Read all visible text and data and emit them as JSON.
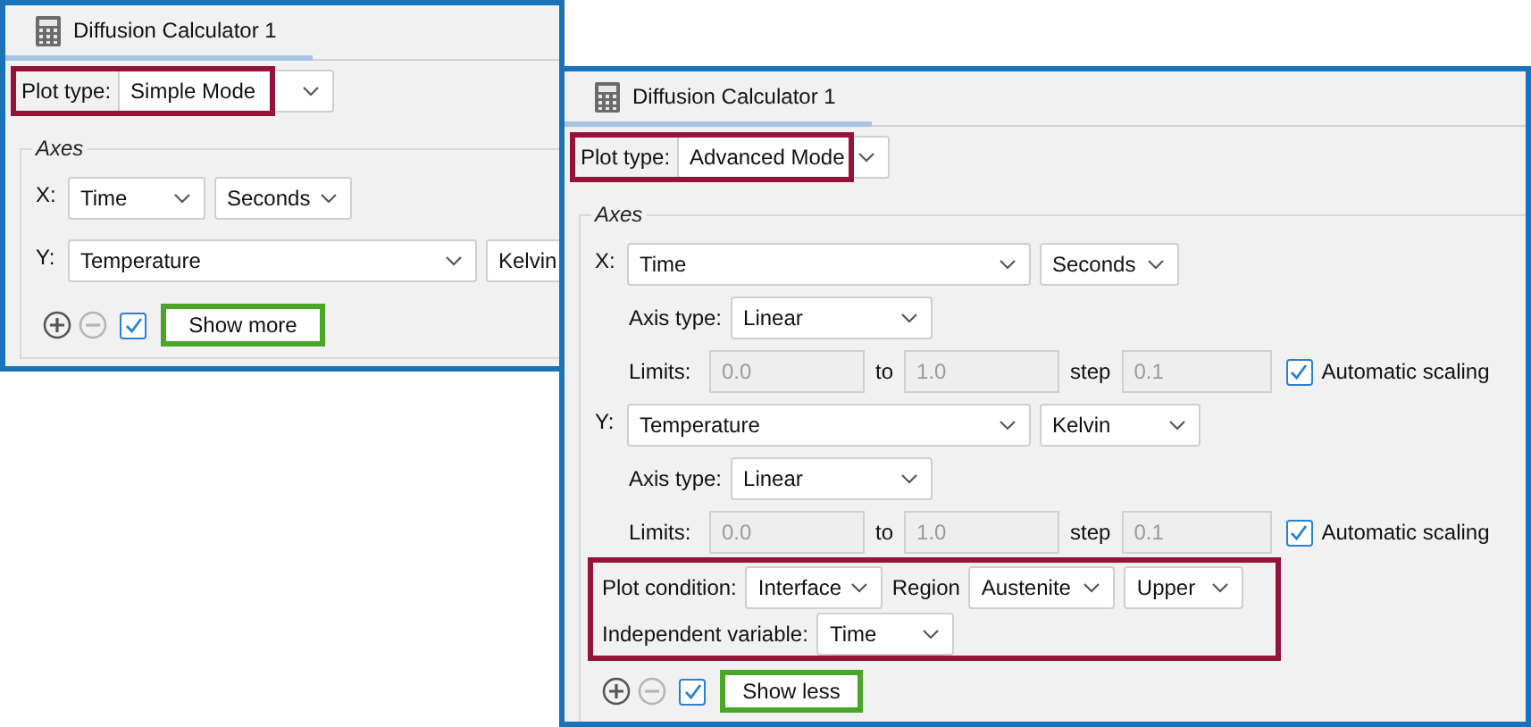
{
  "panels": [
    {
      "kind": "simple",
      "title": "Diffusion Calculator 1",
      "plot_type_label": "Plot type:",
      "plot_type": "Simple Mode",
      "axes_title": "Axes",
      "axes": [
        {
          "label": "X:",
          "quantity": "Time",
          "unit": "Seconds"
        },
        {
          "label": "Y:",
          "quantity": "Temperature",
          "unit": "Kelvin"
        }
      ],
      "toggle_checked": true,
      "toggle_button": "Show more"
    },
    {
      "kind": "advanced",
      "title": "Diffusion Calculator 1",
      "plot_type_label": "Plot type:",
      "plot_type": "Advanced Mode",
      "axes_title": "Axes",
      "axes": [
        {
          "label": "X:",
          "quantity": "Time",
          "unit": "Seconds",
          "axis_type_label": "Axis type:",
          "axis_type": "Linear",
          "limits_label": "Limits:",
          "from": "0.0",
          "to_label": "to",
          "to": "1.0",
          "step_label": "step",
          "step": "0.1",
          "auto_checked": true,
          "auto_label": "Automatic scaling"
        },
        {
          "label": "Y:",
          "quantity": "Temperature",
          "unit": "Kelvin",
          "axis_type_label": "Axis type:",
          "axis_type": "Linear",
          "limits_label": "Limits:",
          "from": "0.0",
          "to_label": "to",
          "to": "1.0",
          "step_label": "step",
          "step": "0.1",
          "auto_checked": true,
          "auto_label": "Automatic scaling"
        }
      ],
      "condition": {
        "condition_label": "Plot condition:",
        "condition": "Interface",
        "region_label": "Region",
        "region": "Austenite",
        "side": "Upper",
        "variable_label": "Independent variable:",
        "variable": "Time"
      },
      "toggle_checked": true,
      "toggle_button": "Show less"
    }
  ]
}
